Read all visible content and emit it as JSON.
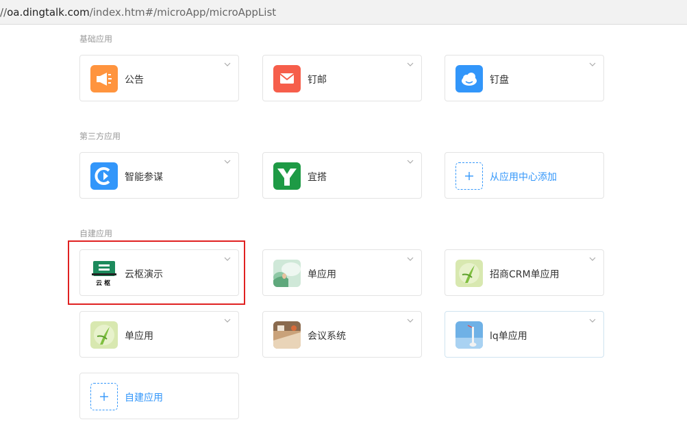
{
  "browser": {
    "url_prefix": "//",
    "url_host": "oa.dingtalk.com",
    "url_path": "/index.htm#/microApp/microAppList"
  },
  "sections": {
    "basic": {
      "title": "基础应用",
      "items": [
        {
          "label": "公告",
          "icon": "megaphone-icon",
          "color": "#ff943e"
        },
        {
          "label": "钉邮",
          "icon": "mail-icon",
          "color": "#f65e4b"
        },
        {
          "label": "钉盘",
          "icon": "cloud-icon",
          "color": "#3296fa"
        }
      ]
    },
    "third_party": {
      "title": "第三方应用",
      "items": [
        {
          "label": "智能参谋",
          "icon": "smart-advisor-icon",
          "color": "#3296fa"
        },
        {
          "label": "宜搭",
          "icon": "yida-icon",
          "color": "#1e9a45"
        }
      ],
      "add_label": "从应用中心添加"
    },
    "custom": {
      "title": "自建应用",
      "items": [
        {
          "label": "云枢演示",
          "icon": "yunshu-logo-icon",
          "logo_text": "云 枢"
        },
        {
          "label": "单应用",
          "icon": "photo-thumbnail-icon"
        },
        {
          "label": "招商CRM单应用",
          "icon": "leaf-thumbnail-icon"
        },
        {
          "label": "单应用",
          "icon": "leaf-thumbnail-icon"
        },
        {
          "label": "会议系统",
          "icon": "meeting-photo-icon"
        },
        {
          "label": "lq单应用",
          "icon": "sky-photo-icon"
        }
      ],
      "add_label": "自建应用"
    }
  },
  "colors": {
    "accent": "#3296fa",
    "highlight": "#e02020",
    "card_border": "#e3e3e3",
    "section_title": "#999999"
  }
}
